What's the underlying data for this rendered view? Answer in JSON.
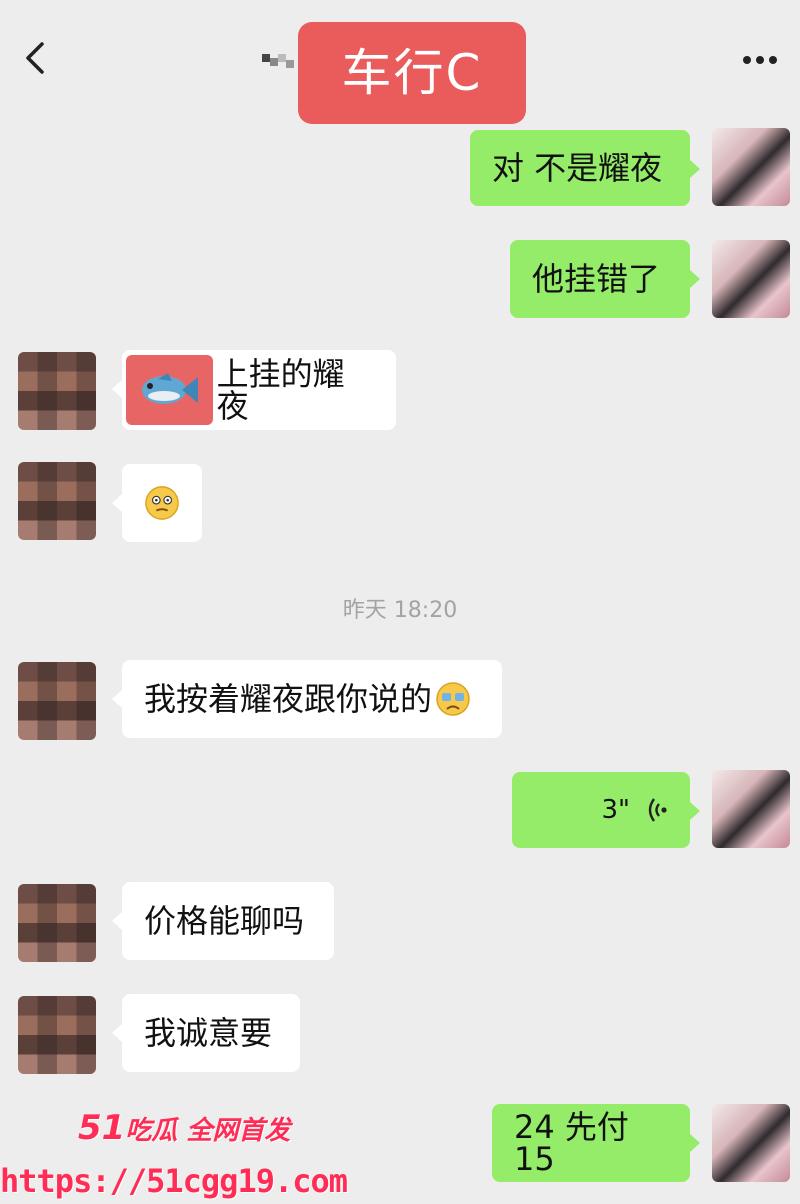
{
  "header": {
    "title": "车行C"
  },
  "messages": {
    "m1": "对 不是耀夜",
    "m2": "他挂错了",
    "m3": "上挂的耀夜",
    "m5": "我按着耀夜跟你说的",
    "m6_voice_duration": "3\"",
    "m7": "价格能聊吗",
    "m8": "我诚意要",
    "m9": "24 先付 15"
  },
  "timestamp": "昨天 18:20",
  "watermark": {
    "brand_num": "51",
    "brand_text": "吃瓜 全网首发",
    "url": "https://51cgg19.com"
  },
  "colors": {
    "background": "#ededed",
    "self_bubble": "#95ec69",
    "other_bubble": "#ffffff",
    "title_badge": "#ea5b5b",
    "watermark": "#ff2d55"
  },
  "icons": [
    "back-arrow",
    "more-dots",
    "fish-emoji",
    "dizzy-face-emoji",
    "crying-emoji",
    "voice-wave"
  ]
}
